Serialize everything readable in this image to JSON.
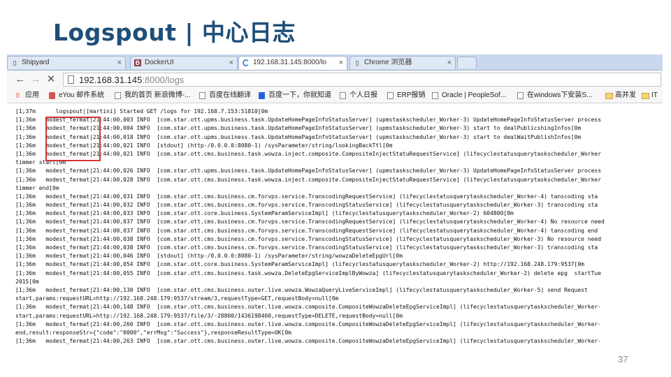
{
  "slide": {
    "title": "Logspout | 中心日志",
    "page_number": "37"
  },
  "browser": {
    "tabs": [
      {
        "label": "Shipyard",
        "icon": "page-icon",
        "active": false
      },
      {
        "label": "DockerUI",
        "icon": "b-logo-icon",
        "active": false
      },
      {
        "label": "192.168.31.145:8000/lo",
        "icon": "loading-spinner-icon",
        "active": true
      },
      {
        "label": "Chrome 浏览器",
        "icon": "page-icon",
        "active": false
      }
    ],
    "tab_close_glyph": "×",
    "address": {
      "host": "192.168.31.145",
      "path": ":8000/logs"
    },
    "bookmarks": [
      {
        "label": "应用",
        "icon": "apps-icon"
      },
      {
        "label": "eYou 邮件系统",
        "icon": "eyou-icon"
      },
      {
        "label": "我的首页 新浪微博-...",
        "icon": "page-icon"
      },
      {
        "label": "百度在线翻译",
        "icon": "page-icon"
      },
      {
        "label": "百度一下，你就知道",
        "icon": "baidu-icon"
      },
      {
        "label": "个人日报",
        "icon": "page-icon"
      },
      {
        "label": "ERP报销",
        "icon": "page-icon"
      },
      {
        "label": "Oracle | PeopleSof...",
        "icon": "page-icon"
      },
      {
        "label": "在windows下安装S...",
        "icon": "page-icon"
      },
      {
        "label": "高并发",
        "icon": "folder-icon"
      },
      {
        "label": "IT",
        "icon": "folder-icon"
      }
    ]
  },
  "logs": [
    "[1;37m      logspout|[martini] Started GET /logs for 192.168.7.153:51810[0m",
    "[1;36m   modest_fermat|21:44:00,003 INFO  [com.star.ott.upms.business.task.UpdateHomePageInfoStatusServer] (upmstaskscheduler_Worker-3) UpdateHomePageInfoStatusServer process",
    "[1;36m   modest_fermat|21:44:00,004 INFO  [com.star.ott.upms.business.task.UpdateHomePageInfoStatusServer] (upmstaskscheduler_Worker-3) start to dealPublicshingInfos[0m",
    "[1;36m   modest_fermat|21:44:00,018 INFO  [com.star.ott.upms.business.task.UpdateHomePageInfoStatusServer] (upmstaskscheduler_Worker-3) start to dealWaitPublishInfos[0m",
    "[1;36m   modest_fermat|21:44:00,021 INFO  [stdout] (http-/0.0.0.0:8080-1) /sysParameter/string/lookingBackTtl[0m",
    "[1;36m   modest_fermat|21:44:00,021 INFO  [com.star.ott.cms.business.task.wowza.inject.composite.CompositeInjectStatuRequestService] (lifecyclestatusquerytaskscheduler_Worker",
    "timmer start[0m",
    "[1;36m   modest_fermat|21:44:00,026 INFO  [com.star.ott.upms.business.task.UpdateHomePageInfoStatusServer] (upmstaskscheduler_Worker-3) UpdateHomePageInfoStatusServer process",
    "[1;36m   modest_fermat|21:44:00,028 INFO  [com.star.ott.cms.business.task.wowza.inject.composite.CompositeInjectStatuRequestService] (lifecyclestatusquerytaskscheduler_Worker",
    "timmer end[0m",
    "[1;36m   modest_fermat|21:44:00,031 INFO  [com.star.ott.cms.business.cm.forvps.service.TranscodingRequestService] (lifecyclestatusquerytaskscheduler_Worker-4) tanscoding sta",
    "[1;36m   modest_fermat|21:44:00,032 INFO  [com.star.ott.cms.business.cm.forvps.service.TranscodingStatusService] (lifecyclestatusquerytaskscheduler_Worker-3) transcoding sta",
    "[1;36m   modest_fermat|21:44:00,033 INFO  [com.star.ott.core.business.SystemParamServiceImpl] (lifecyclestatusquerytaskscheduler_Worker-2) 604800[0m",
    "[1;36m   modest_fermat|21:44:00,037 INFO  [com.star.ott.cms.business.cm.forvps.service.TranscodingRequestService] (lifecyclestatusquerytaskscheduler_Worker-4) No resource need",
    "[1;36m   modest_fermat|21:44:00,037 INFO  [com.star.ott.cms.business.cm.forvps.service.TranscodingRequestService] (lifecyclestatusquerytaskscheduler_Worker-4) tanscoding end",
    "[1;36m   modest_fermat|21:44:00,038 INFO  [com.star.ott.cms.business.cm.forvps.service.TranscodingStatusService] (lifecyclestatusquerytaskscheduler_Worker-3) No resource need",
    "[1;36m   modest_fermat|21:44:00,038 INFO  [com.star.ott.cms.business.cm.forvps.service.TranscodingStatusService] (lifecyclestatusquerytaskscheduler_Worker-3) transcoding sta",
    "[1;36m   modest_fermat|21:44:00,046 INFO  [stdout] (http-/0.0.0.0:8080-1) /sysParameter/string/wowzaDeleteEpgUrl[0m",
    "[1;36m   modest_fermat|21:44:00,054 INFO  [com.star.ott.core.business.SystemParamServiceImpl] (lifecyclestatusquerytaskscheduler_Worker-2) http://192.168.248.179:9537[0m",
    "[1;36m   modest_fermat|21:44:00,055 INFO  [com.star.ott.cms.business.task.wowza.DeleteEpgServiceImplByWowza] (lifecyclestatusquerytaskscheduler_Worker-2) delete epg  startTue",
    "2015[0m",
    "[1;36m   modest_fermat|21:44:00,130 INFO  [com.star.ott.cms.business.outer.live.wowza.WowzaQueryLiveServiceImpl] (lifecyclestatusquerytaskscheduler_Worker-5) send Request",
    "start,params:requestURL=http://192.168.248.179:9537/stream/3,requestType=GET,requestBody=null[0m",
    "[1;36m   modest_fermat|21:44:00,148 INFO  [com.star.ott.cms.business.outer.live.wowza.composite.CompositeWowzaDeleteEpgServiceImpl] (lifecyclestatusquerytaskscheduler_Worker-",
    "start,params:requestURL=http://192.168.248.179:9537/file/3/-28800/1436198400,requestType=DELETE,requestBody=null[0m",
    "[1;36m   modest_fermat|21:44:00,260 INFO  [com.star.ott.cms.business.outer.live.wowza.composite.CompositeWowzaDeleteEpgServiceImpl] (lifecyclestatusquerytaskscheduler_Worker-",
    "end,result:responseStr={\"code\":\"0000\",\"errMsg\":\"Success\"},responseResultType=OK[0m",
    "[1;36m   modest_fermat|21:44:00,263 INFO  [com.star.ott.cms.business.outer.live.wowza.composite.CompositeWowzaDeleteEpgServiceImpl] (lifecyclestatusquerytaskscheduler_Worker-"
  ]
}
